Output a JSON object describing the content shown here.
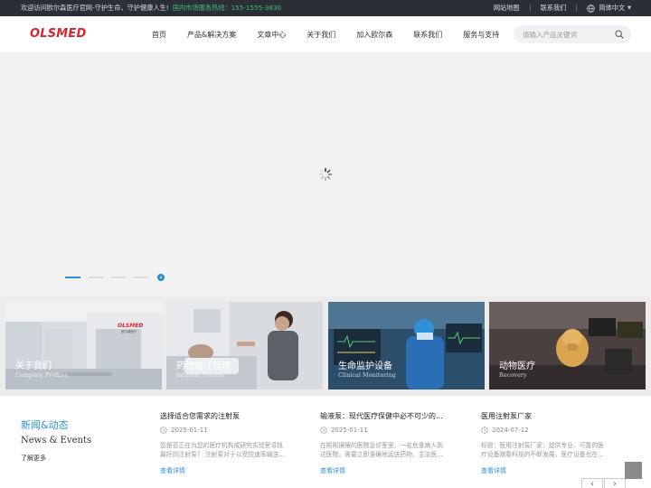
{
  "topbar": {
    "welcome": "欢迎访问欧尔森医疗官网-守护生命，守护健康人生!",
    "hotline": "国内市场服务热线：155-1555-3830",
    "sitemap": "网站地图",
    "contact": "联系我们",
    "language": "简体中文"
  },
  "header": {
    "logo": "OLSMED",
    "nav": [
      "首页",
      "产品&解决方案",
      "文章中心",
      "关于我们",
      "加入欧尔森",
      "联系我们",
      "服务与支持"
    ],
    "search_placeholder": "请输入产品关键词"
  },
  "banner": {
    "slide_count": 5,
    "active_slide": 1
  },
  "cards": [
    {
      "title": "关于我们",
      "subtitle": "Company Profiles",
      "sign": "OLSMED",
      "sign_cn": "欧尔森医疗"
    },
    {
      "title": "药物输注管理",
      "subtitle": "Infusion System"
    },
    {
      "title": "生命监护设备",
      "subtitle": "Clinical Monitoring"
    },
    {
      "title": "动物医疗",
      "subtitle": "Recovery"
    }
  ],
  "news": {
    "title_cn": "新闻&动态",
    "title_en": "News & Events",
    "more": "了解更多",
    "articles": [
      {
        "title": "选择适合您需求的注射泵",
        "date": "2025-01-11",
        "desc": "您是否正在为您的医疗机构或研究实验室寻找最好的注射泵？ 注射泵对于以受控速率输送…",
        "read": "查看详情"
      },
      {
        "title": "输液泵：现代医疗保健中必不可少的…",
        "date": "2025-01-11",
        "desc": "在熙熙攘攘的医院急诊室里，一名危重病人到达医院，需要立即准确地运送药物。主治医…",
        "read": "查看详情"
      },
      {
        "title": "医用注射泵厂家",
        "date": "2024-07-12",
        "desc": "标题：医用注射泵厂家：提供专业、可靠的医疗设备随着科技的不断发展，医疗设备也在…",
        "read": "查看详情"
      }
    ],
    "prev": "‹",
    "next": "›"
  },
  "colors": {
    "accent": "#2b8fd6",
    "brand": "#d8262f",
    "topbar": "#2a2f35"
  }
}
